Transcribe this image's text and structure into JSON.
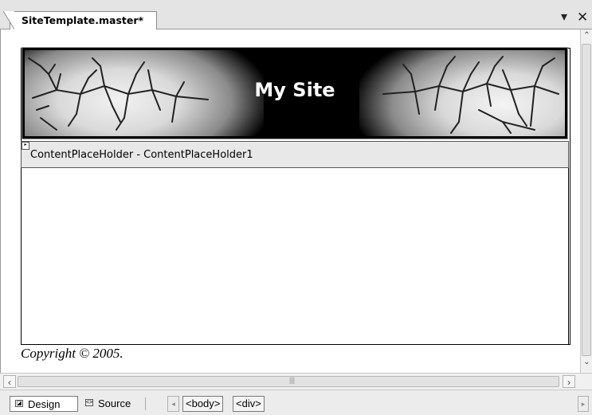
{
  "document_tab": {
    "title": "SiteTemplate.master*"
  },
  "window_controls": {
    "menu_glyph": "▾",
    "close_glyph": "✕"
  },
  "header": {
    "site_title": "My Site"
  },
  "content_placeholder": {
    "label": "ContentPlaceHolder - ContentPlaceHolder1"
  },
  "footer": {
    "copyright": "Copyright © 2005."
  },
  "view_tabs": [
    {
      "label": "Design",
      "icon": "design-view-icon",
      "active": true
    },
    {
      "label": "Source",
      "icon": "source-view-icon",
      "active": false
    }
  ],
  "tag_path": {
    "items": [
      "<body>",
      "<div>"
    ]
  },
  "colors": {
    "surface": "#ffffff",
    "chrome": "#ececec",
    "banner": "#000000",
    "placeholder_bar": "#e8e8e8"
  }
}
